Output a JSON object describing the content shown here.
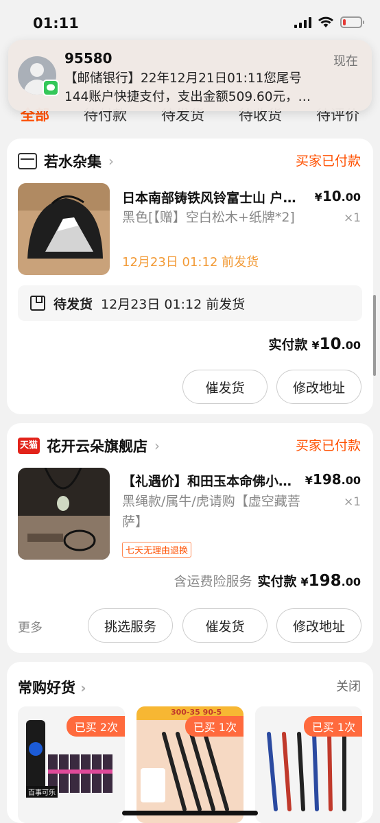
{
  "status_bar": {
    "time": "01:11"
  },
  "notification": {
    "sender": "95580",
    "time": "现在",
    "line1": "【邮储银行】22年12月21日01:11您尾号",
    "line2": "144账户快捷支付，支出金额509.60元，…"
  },
  "tabs": [
    {
      "label": "全部"
    },
    {
      "label": "待付款"
    },
    {
      "label": "待发货"
    },
    {
      "label": "待收货"
    },
    {
      "label": "待评价"
    }
  ],
  "order1": {
    "shop_name": "若水杂集",
    "status": "买家已付款",
    "product_title": "日本南部铸铁风铃富士山 户…",
    "price_symbol": "¥",
    "price_int": "10",
    "price_dec": ".00",
    "spec": "黑色[【赠】空白松木+纸牌*2]",
    "quantity": "×1",
    "ship_deadline": "12月23日 01:12 前发货",
    "ship_box_label": "待发货",
    "ship_box_text": "12月23日 01:12 前发货",
    "total_label": "实付款",
    "total_symbol": "¥",
    "total_int": "10",
    "total_dec": ".00",
    "btn_urge": "催发货",
    "btn_address": "修改地址"
  },
  "order2": {
    "shop_name": "花开云朵旗舰店",
    "shop_badge": "天猫",
    "status": "买家已付款",
    "product_title": "【礼遇价】和田玉本命佛小…",
    "price_symbol": "¥",
    "price_int": "198",
    "price_dec": ".00",
    "spec": "黑绳款/属牛/虎请购【虚空藏菩萨】",
    "quantity": "×1",
    "return_badge": "七天无理由退换",
    "service_note": "含运费险服务",
    "total_label": "实付款",
    "total_symbol": "¥",
    "total_int": "198",
    "total_dec": ".00",
    "more": "更多",
    "btn_service": "挑选服务",
    "btn_urge": "催发货",
    "btn_address": "修改地址"
  },
  "recommend": {
    "title": "常购好货",
    "close": "关闭",
    "items": [
      {
        "badge": "已买 2次",
        "image_text": "百事可乐"
      },
      {
        "badge": "已买 1次",
        "image_text": "300-35 90-5"
      },
      {
        "badge": "已买 1次",
        "image_text": ""
      }
    ]
  },
  "colors": {
    "accent": "#ff5000",
    "ship_orange": "#f29a36",
    "tmall_red": "#e2231a"
  }
}
